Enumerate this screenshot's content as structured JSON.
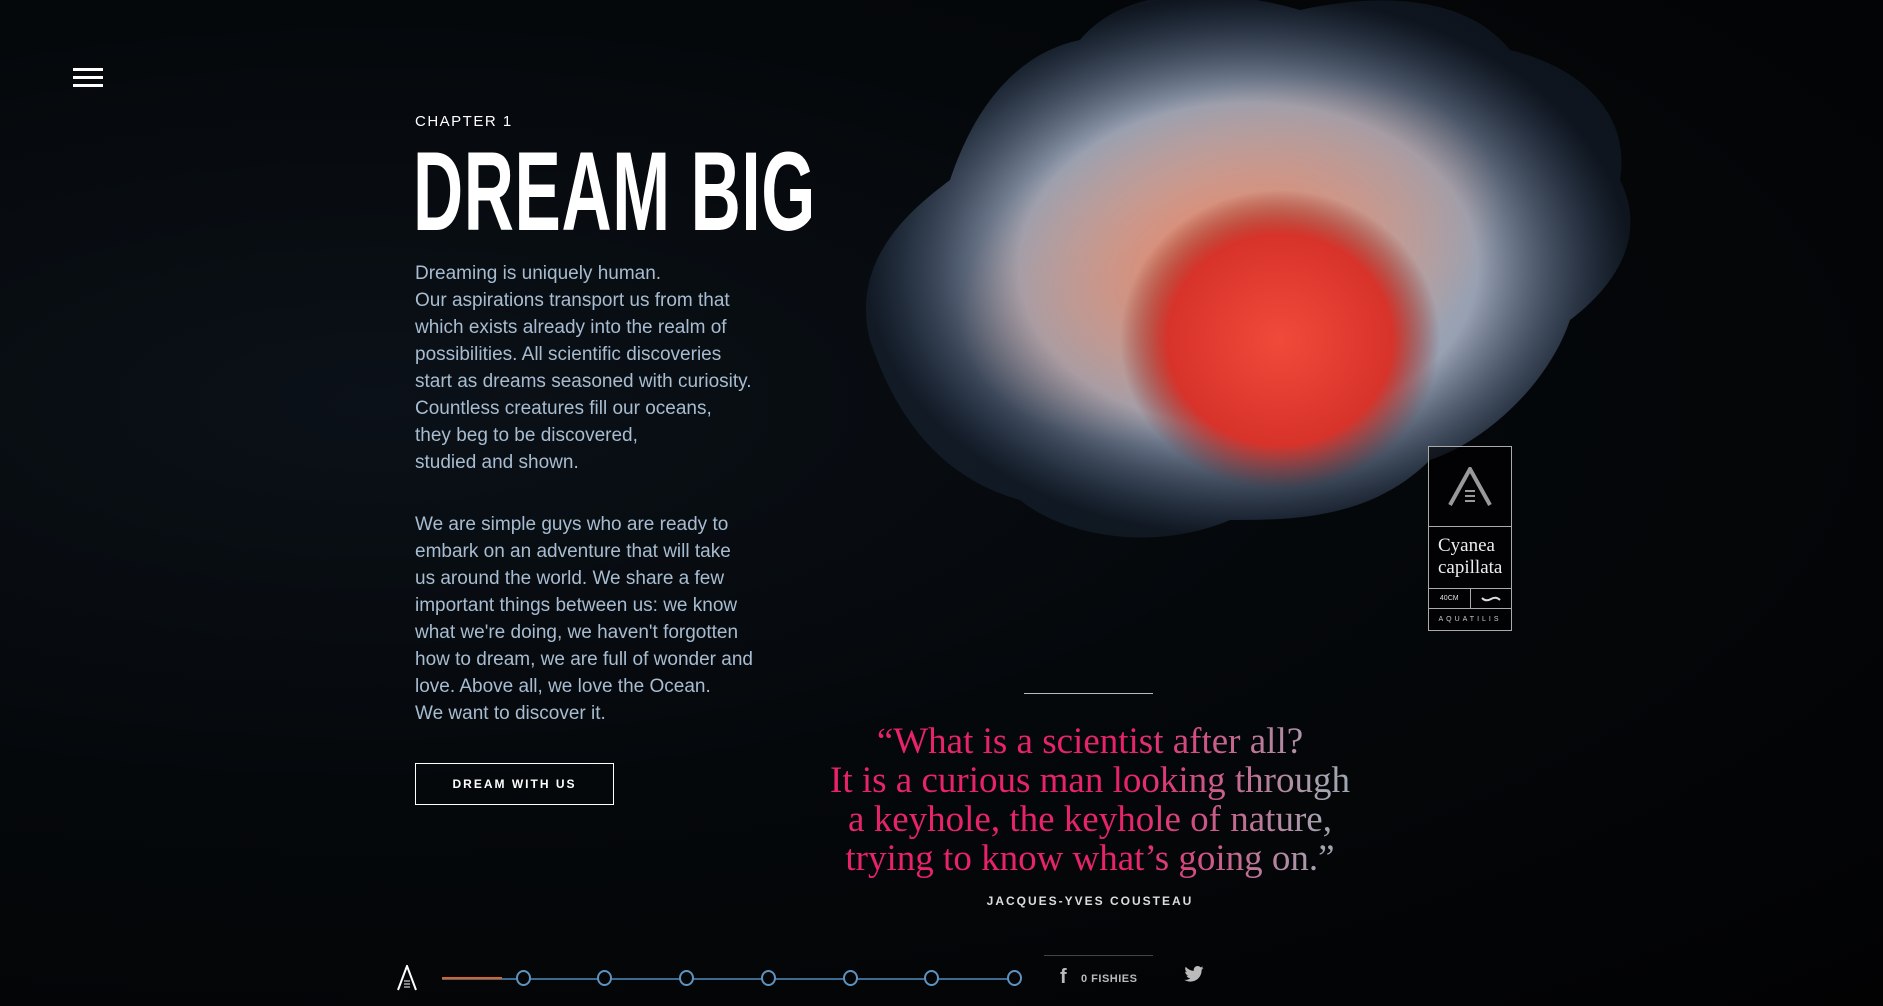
{
  "menu": {
    "icon": "hamburger-icon"
  },
  "chapter": "CHAPTER 1",
  "title": "DREAM BIG",
  "paragraph1": [
    "Dreaming is uniquely human.",
    "Our aspirations transport us from that",
    "which exists already into the realm of",
    "possibilities. All scientific discoveries",
    "start as dreams seasoned with curiosity.",
    "Countless creatures fill our oceans,",
    "they beg to be discovered,",
    "studied and shown."
  ],
  "paragraph2": [
    "We are simple guys who are ready to",
    "embark on an adventure that will take",
    "us around the world. We share a few",
    "important things between us: we know",
    "what we're doing, we haven't forgotten",
    "how to dream, we are full of wonder and",
    "love. Above all, we love the Ocean.",
    "We want to discover it."
  ],
  "cta": "DREAM WITH US",
  "species_card": {
    "name_line1": "Cyanea",
    "name_line2": "capillata",
    "size": "40CM",
    "brand": "AQUATILIS"
  },
  "quote": {
    "lines": [
      "“What is a scientist after all?",
      "It is a curious man looking through",
      "a keyhole, the keyhole of nature,",
      "trying to know what’s going on.”"
    ],
    "author": "JACQUES-YVES COUSTEAU"
  },
  "nav": {
    "steps": 7,
    "progress_color": "#e1611a",
    "track_color": "#3f6a90"
  },
  "social": {
    "facebook_count": "0 FISHIES",
    "icons": [
      "facebook-icon",
      "twitter-icon"
    ]
  },
  "colors": {
    "quote": "#e8236a",
    "body": "#a7bcd0"
  }
}
